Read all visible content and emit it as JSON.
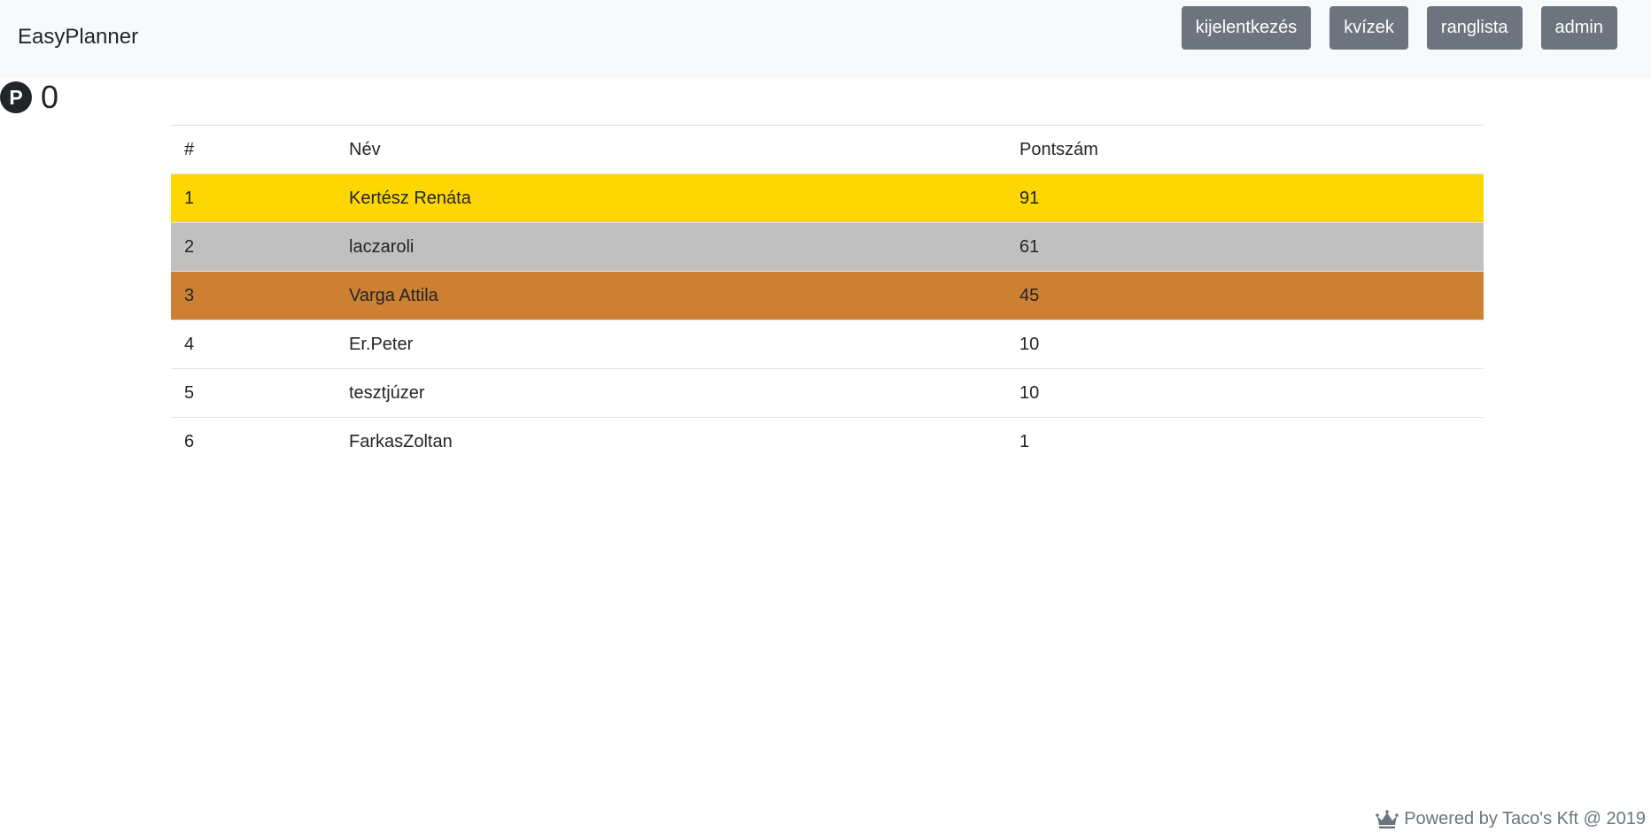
{
  "navbar": {
    "brand": "EasyPlanner",
    "buttons": [
      {
        "label": "kijelentkezés"
      },
      {
        "label": "kvízek"
      },
      {
        "label": "ranglista"
      },
      {
        "label": "admin"
      }
    ]
  },
  "points": {
    "icon_letter": "P",
    "value": "0"
  },
  "leaderboard": {
    "headers": [
      "#",
      "Név",
      "Pontszám"
    ],
    "rows": [
      {
        "rank": "1",
        "name": "Kertész Renáta",
        "score": "91",
        "highlight": "#ffd700"
      },
      {
        "rank": "2",
        "name": "laczaroli",
        "score": "61",
        "highlight": "#c0c0c0"
      },
      {
        "rank": "3",
        "name": "Varga Attila",
        "score": "45",
        "highlight": "#cd7f32"
      },
      {
        "rank": "4",
        "name": "Er.Peter",
        "score": "10"
      },
      {
        "rank": "5",
        "name": "tesztjúzer",
        "score": "10"
      },
      {
        "rank": "6",
        "name": "FarkasZoltan",
        "score": "1"
      }
    ]
  },
  "footer": {
    "icon": "crown-icon",
    "text": "Powered by Taco's Kft @ 2019"
  },
  "colors": {
    "navbar_bg": "#f8f9fa",
    "button_bg": "#6c757d",
    "gold": "#ffd700",
    "silver": "#c0c0c0",
    "bronze": "#cd7f32"
  }
}
